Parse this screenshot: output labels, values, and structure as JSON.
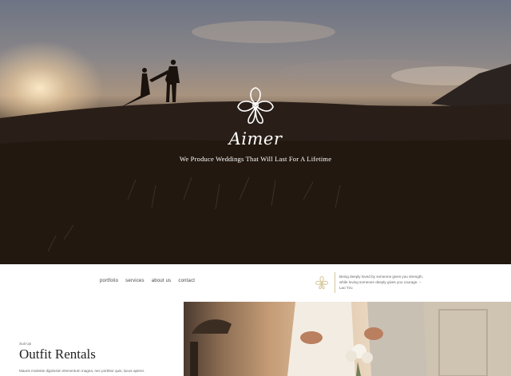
{
  "hero": {
    "brand": "Aimer",
    "tagline": "We Produce Weddings That Will Last For A Lifetime"
  },
  "nav": {
    "items": [
      "portfolio",
      "services",
      "about us",
      "contact"
    ]
  },
  "quote": {
    "text": "Being deeply loved by someone gives you strength, while loving someone deeply gives you courage. – Lao Tzu"
  },
  "section": {
    "kicker": "Suit Up",
    "title": "Outfit Rentals",
    "desc": "Mauris molestie dignissim elementum magna, nec porttitor quis, lacus aptent."
  },
  "colors": {
    "accent": "#d5c89a",
    "text": "#222222"
  },
  "icons": {
    "logo": "flower-icon"
  }
}
